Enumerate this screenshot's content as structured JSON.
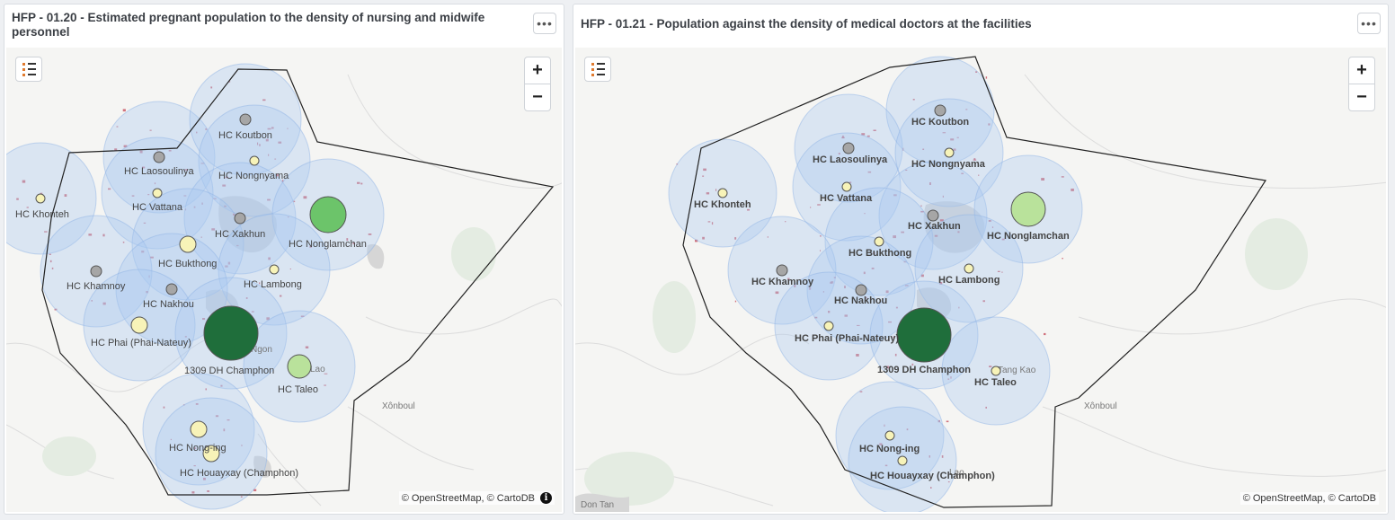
{
  "panels": [
    {
      "title": "HFP - 01.20 - Estimated pregnant population to the density of nursing and midwife personnel",
      "menu_label": "•••",
      "zoom_in": "+",
      "zoom_out": "−",
      "attribution": "© OpenStreetMap, © CartoDB",
      "info_label": "i",
      "place_names": [
        "Xônboul",
        "Ngon",
        "Lao"
      ],
      "facilities": [
        {
          "name": "HC Khonteh",
          "marker": "light-yellow"
        },
        {
          "name": "HC Laosoulinya",
          "marker": "grey"
        },
        {
          "name": "HC Koutbon",
          "marker": "grey"
        },
        {
          "name": "HC Nongnyama",
          "marker": "light-yellow"
        },
        {
          "name": "HC Vattana",
          "marker": "light-yellow"
        },
        {
          "name": "HC Xakhun",
          "marker": "grey"
        },
        {
          "name": "HC Nonglamchan",
          "marker": "green"
        },
        {
          "name": "HC Bukthong",
          "marker": "light-yellow"
        },
        {
          "name": "HC Khamnoy",
          "marker": "grey"
        },
        {
          "name": "HC Lambong",
          "marker": "light-yellow"
        },
        {
          "name": "HC Nakhou",
          "marker": "grey"
        },
        {
          "name": "HC Phai (Phai-Nateuy)",
          "marker": "light-yellow"
        },
        {
          "name": "1309 DH Champhon",
          "marker": "dark-green"
        },
        {
          "name": "HC Taleo",
          "marker": "light-green"
        },
        {
          "name": "HC Nong-ing",
          "marker": "light-yellow"
        },
        {
          "name": "HC Houayxay (Champhon)",
          "marker": "light-yellow"
        }
      ]
    },
    {
      "title": "HFP - 01.21 - Population against the density of medical doctors at the facilities",
      "menu_label": "•••",
      "zoom_in": "+",
      "zoom_out": "−",
      "attribution": "© OpenStreetMap, © CartoDB",
      "place_names": [
        "Xônboul",
        "Don Tan",
        "Tang Kao",
        "Lao"
      ],
      "facilities": [
        {
          "name": "HC Khonteh",
          "marker": "light-yellow"
        },
        {
          "name": "HC Koutbon",
          "marker": "grey"
        },
        {
          "name": "HC Laosoulinya",
          "marker": "grey"
        },
        {
          "name": "HC Nongnyama",
          "marker": "light-yellow"
        },
        {
          "name": "HC Vattana",
          "marker": "light-yellow"
        },
        {
          "name": "HC Xakhun",
          "marker": "grey"
        },
        {
          "name": "HC Nonglamchan",
          "marker": "light-green"
        },
        {
          "name": "HC Bukthong",
          "marker": "light-yellow"
        },
        {
          "name": "HC Khamnoy",
          "marker": "grey"
        },
        {
          "name": "HC Lambong",
          "marker": "light-yellow"
        },
        {
          "name": "HC Nakhou",
          "marker": "grey"
        },
        {
          "name": "HC Phai (Phai-Nateuy)",
          "marker": "light-yellow"
        },
        {
          "name": "1309 DH Champhon",
          "marker": "dark-green"
        },
        {
          "name": "HC Taleo",
          "marker": "light-yellow"
        },
        {
          "name": "HC Nong-ing",
          "marker": "light-yellow"
        },
        {
          "name": "HC Houayxay (Champhon)",
          "marker": "light-yellow"
        }
      ]
    }
  ],
  "colors": {
    "catchment_fill": "#a9c8f0",
    "catchment_stroke": "#8fb3e6",
    "grey": "#a6a6a6",
    "light-yellow": "#f7f3b8",
    "light-green": "#b9e29b",
    "green": "#6cc46a",
    "dark-green": "#1f6e3b",
    "boundary": "#222222",
    "settlement": "#c23a4a"
  }
}
